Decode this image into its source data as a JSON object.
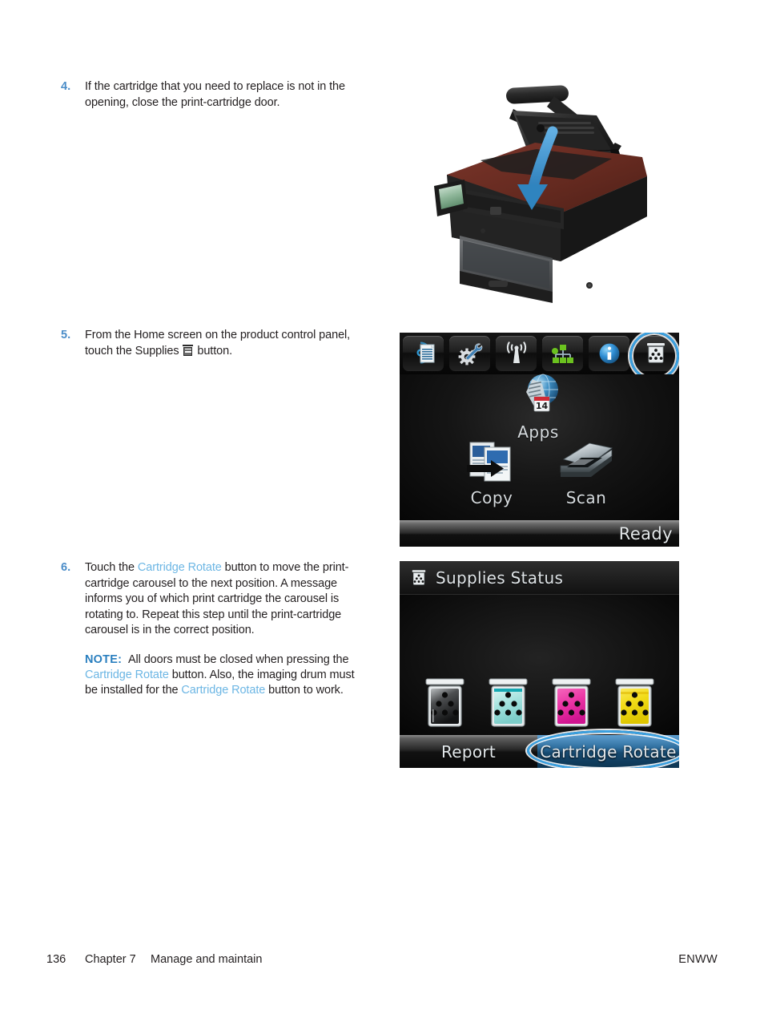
{
  "document": {
    "page_number": "136",
    "chapter": "Chapter 7",
    "chapter_title": "Manage and maintain",
    "footer_right": "ENWW"
  },
  "steps": [
    {
      "number": "4.",
      "text_part1": "If the cartridge that you need to replace is not in the opening, close the print-cartridge door."
    },
    {
      "number": "5.",
      "text_part1": "From the Home screen on the product control panel, touch the Supplies ",
      "icon": "supplies-icon",
      "text_part2": " button."
    },
    {
      "number": "6.",
      "text_part1": "Touch the ",
      "ui_ref1": "Cartridge Rotate",
      "text_part2": " button to move the print-cartridge carousel to the next position. A message informs you of which print cartridge the carousel is rotating to. Repeat this step until the print-cartridge carousel is in the correct position.",
      "note": {
        "label": "NOTE:",
        "text_part1": "All doors must be closed when pressing the ",
        "ui_ref1": "Cartridge Rotate",
        "text_part2": " button. Also, the imaging drum must be installed for the ",
        "ui_ref2": "Cartridge Rotate",
        "text_part3": " button to work."
      }
    }
  ],
  "illustration": {
    "name": "printer-closing-print-cartridge-door",
    "caption": "",
    "arrow_color": "#3d8fcc",
    "body_color": "#1c1c1c",
    "top_panel_color": "#6b2e22"
  },
  "home_screen": {
    "toolbar": [
      {
        "name": "web-services-icon",
        "label": "Web Services"
      },
      {
        "name": "setup-wrench-gear-icon",
        "label": "Setup"
      },
      {
        "name": "wireless-icon",
        "label": "Wireless"
      },
      {
        "name": "network-icon",
        "label": "Network"
      },
      {
        "name": "information-icon",
        "label": "Information"
      },
      {
        "name": "supplies-icon",
        "label": "Supplies"
      }
    ],
    "highlighted_toolbar_item": "supplies-icon",
    "tiles": [
      {
        "name": "apps-tile",
        "label": "Apps",
        "icon": "globe-calendar-icon",
        "badge": "14"
      },
      {
        "name": "copy-tile",
        "label": "Copy",
        "icon": "copy-pages-arrow-icon"
      },
      {
        "name": "scan-tile",
        "label": "Scan",
        "icon": "flatbed-scanner-icon"
      }
    ],
    "status": "Ready"
  },
  "supplies_screen": {
    "title": "Supplies Status",
    "title_icon": "supplies-icon",
    "cartridges": [
      {
        "name": "cartridge-black",
        "color": "#3b3b3b",
        "accent": "#111111"
      },
      {
        "name": "cartridge-cyan",
        "color": "#a8e4e0",
        "accent": "#1aa9b5"
      },
      {
        "name": "cartridge-magenta",
        "color": "#ec3fa8",
        "accent": "#d4168f"
      },
      {
        "name": "cartridge-yellow",
        "color": "#f2da18",
        "accent": "#d8bf00"
      }
    ],
    "buttons": [
      {
        "name": "report-button",
        "label": "Report",
        "highlighted": false
      },
      {
        "name": "cartridge-rotate-button",
        "label": "Cartridge Rotate",
        "highlighted": true
      }
    ],
    "highlight_color": "#3aa0e0"
  }
}
